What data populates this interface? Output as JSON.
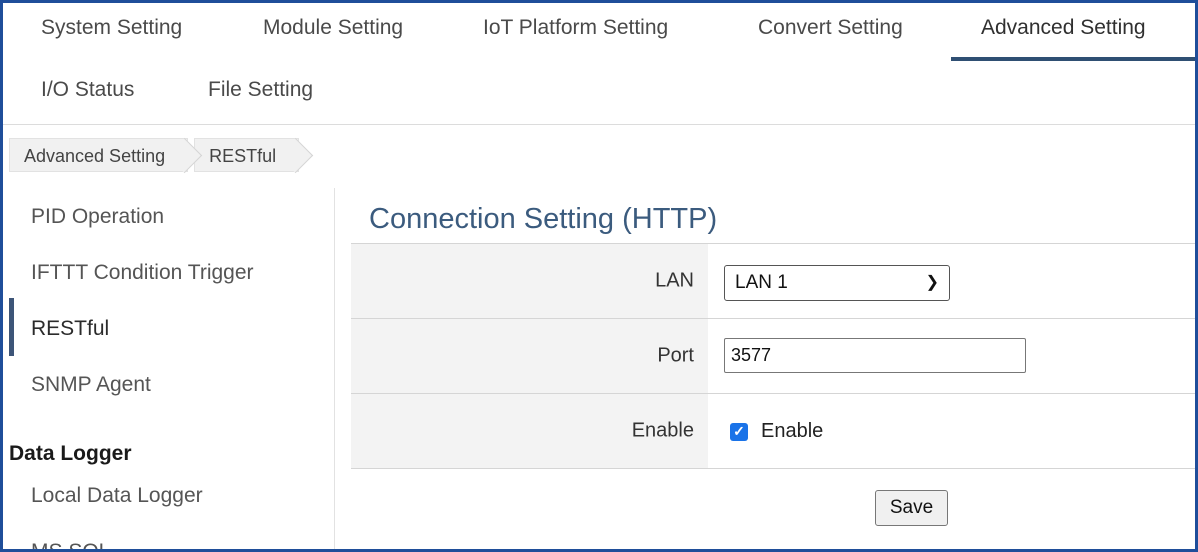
{
  "tabs": {
    "system": "System Setting",
    "module": "Module Setting",
    "iot": "IoT Platform Setting",
    "convert": "Convert Setting",
    "advanced": "Advanced Setting",
    "io_status": "I/O Status",
    "file": "File Setting"
  },
  "breadcrumb": [
    "Advanced Setting",
    "RESTful"
  ],
  "sidebar": {
    "items": [
      "PID Operation",
      "IFTTT Condition Trigger",
      "RESTful",
      "SNMP Agent"
    ],
    "section_heading": "Data Logger",
    "section_items": [
      "Local Data Logger",
      "MS SQL"
    ]
  },
  "panel": {
    "title": "Connection Setting (HTTP)",
    "lan_label": "LAN",
    "lan_value": "LAN 1",
    "port_label": "Port",
    "port_value": "3577",
    "enable_label": "Enable",
    "enable_checkbox_label": "Enable",
    "save_label": "Save"
  },
  "colors": {
    "accent": "#2f4f73",
    "frame": "#1f4e9a",
    "checkbox": "#1a73e8",
    "title": "#3b5b7e"
  }
}
